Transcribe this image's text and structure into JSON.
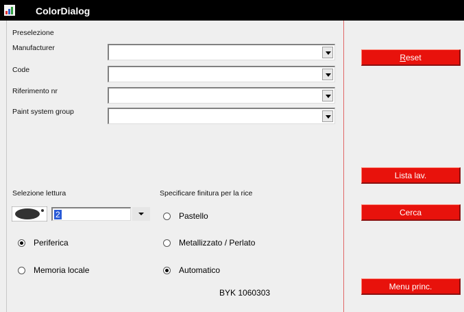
{
  "window": {
    "title": "ColorDialog",
    "accent": "#e8120c"
  },
  "preselection": {
    "heading": "Preselezione",
    "fields": [
      {
        "label": "Manufacturer",
        "value": ""
      },
      {
        "label": "Code",
        "value": ""
      },
      {
        "label": "Riferimento nr",
        "value": ""
      },
      {
        "label": "Paint system group",
        "value": ""
      }
    ]
  },
  "reading": {
    "heading": "Selezione lettura",
    "value": "2",
    "options": [
      {
        "label": "Periferica",
        "selected": true
      },
      {
        "label": "Memoria locale",
        "selected": false
      }
    ]
  },
  "finish": {
    "heading": "Specificare finitura per la rice",
    "options": [
      {
        "label": "Pastello",
        "selected": false
      },
      {
        "label": "Metallizzato / Perlato",
        "selected": false
      },
      {
        "label": "Automatico",
        "selected": true
      }
    ]
  },
  "buttons": {
    "reset_mnemonic": "R",
    "reset_rest": "eset",
    "worklist": "Lista lav.",
    "search": "Cerca",
    "main_menu": "Menu princ."
  },
  "footer": {
    "device": "BYK 1060303"
  }
}
